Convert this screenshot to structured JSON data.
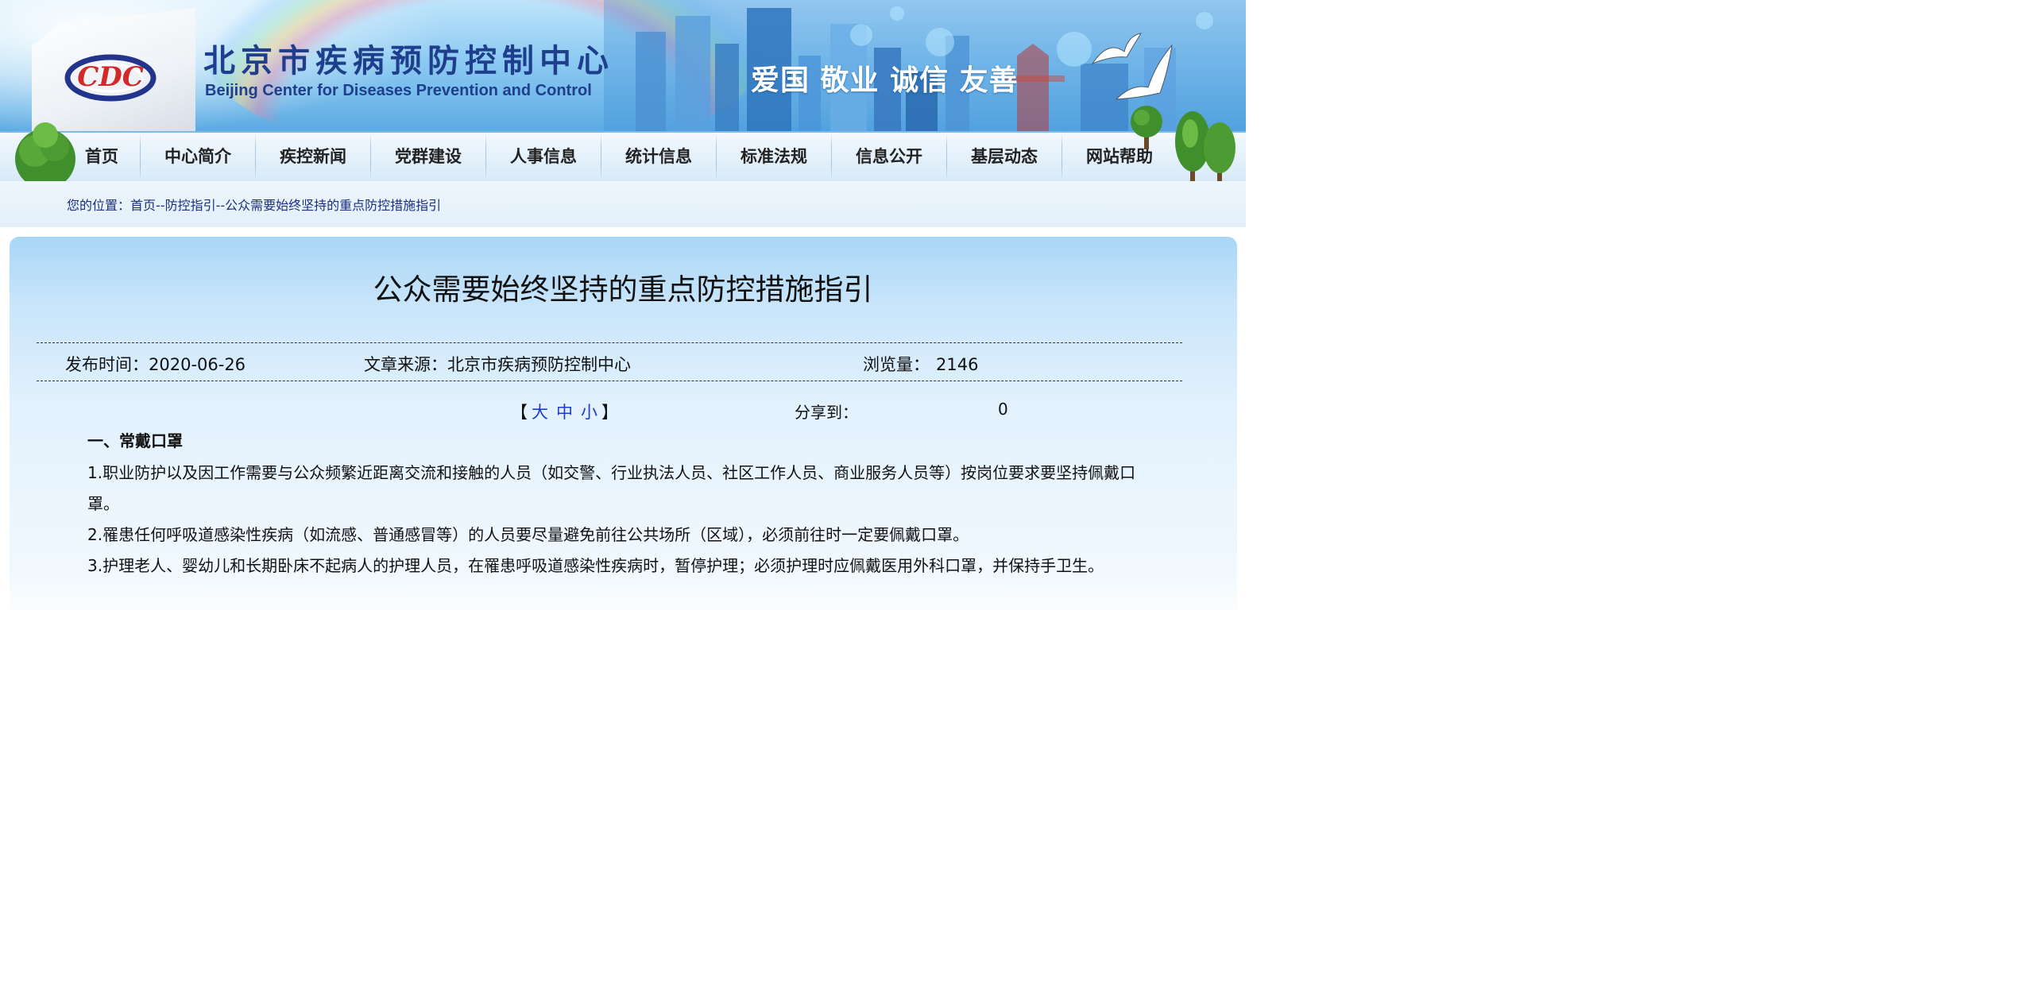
{
  "header": {
    "site_title": "北京市疾病预防控制中心",
    "site_subtitle": "Beijing Center for Diseases Prevention and Control",
    "slogan": "爱国 敬业 诚信 友善",
    "logo_icon": "cdc-logo-icon",
    "colors": {
      "title": "#1f3f8c",
      "sky": "#8ccaf2"
    }
  },
  "nav": {
    "items": [
      {
        "label": "首页"
      },
      {
        "label": "中心简介"
      },
      {
        "label": "疾控新闻"
      },
      {
        "label": "党群建设"
      },
      {
        "label": "人事信息"
      },
      {
        "label": "统计信息"
      },
      {
        "label": "标准法规"
      },
      {
        "label": "信息公开"
      },
      {
        "label": "基层动态"
      },
      {
        "label": "网站帮助"
      }
    ]
  },
  "breadcrumb": {
    "prefix": "您的位置：",
    "home": "首页",
    "sep1": "--",
    "section": "防控指引",
    "sep2": "--",
    "current": "公众需要始终坚持的重点防控措施指引"
  },
  "article": {
    "title": "公众需要始终坚持的重点防控措施指引",
    "publish_label": "发布时间：",
    "publish_date": "2020-06-26",
    "source_label": "文章来源：",
    "source": "北京市疾病预防控制中心",
    "views_label": "浏览量：",
    "views": "2146",
    "font_size": {
      "open": "【",
      "large": "大",
      "medium": "中",
      "small": "小",
      "close": "】"
    },
    "share_label": "分享到：",
    "share_count": "0",
    "section_heading": "一、常戴口罩",
    "paragraphs": [
      "1.职业防护以及因工作需要与公众频繁近距离交流和接触的人员（如交警、行业执法人员、社区工作人员、商业服务人员等）按岗位要求要坚持佩戴口罩。",
      "2.罹患任何呼吸道感染性疾病（如流感、普通感冒等）的人员要尽量避免前往公共场所（区域），必须前往时一定要佩戴口罩。",
      "3.护理老人、婴幼儿和长期卧床不起病人的护理人员，在罹患呼吸道感染性疾病时，暂停护理；必须护理时应佩戴医用外科口罩，并保持手卫生。"
    ]
  }
}
